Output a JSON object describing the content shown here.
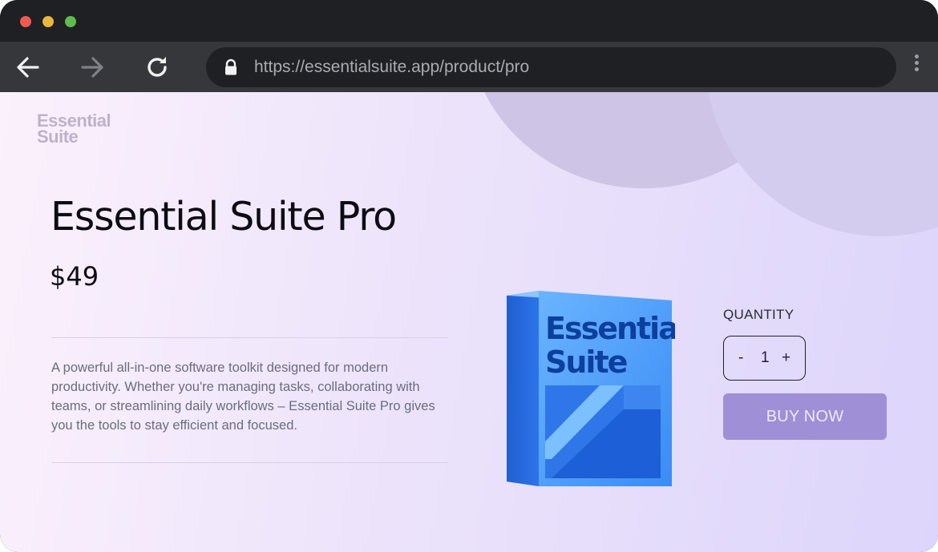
{
  "browser": {
    "url": "https://essentialsuite.app/product/pro",
    "icons": [
      "back-arrow-icon",
      "forward-arrow-icon",
      "reload-icon",
      "lock-icon",
      "more-vertical-icon"
    ]
  },
  "page": {
    "logo_line1": "Essential",
    "logo_line2": "Suite",
    "title": "Essential Suite Pro",
    "price": "$49",
    "description": "A powerful all-in-one software toolkit designed for modern productivity. Whether you're managing tasks, collaborating with teams, or streamlining daily workflows – Essential Suite Pro gives you the tools to stay efficient and focused.",
    "box_text_line1": "Essential",
    "box_text_line2": "Suite"
  },
  "purchase": {
    "quantity_label": "QUANTITY",
    "minus": "-",
    "quantity": "1",
    "plus": "+",
    "buy_label": "BUY NOW"
  },
  "colors": {
    "button": "#9e8fd6",
    "box_blue": "#2f7ff0",
    "box_text": "#0d3f9e"
  }
}
